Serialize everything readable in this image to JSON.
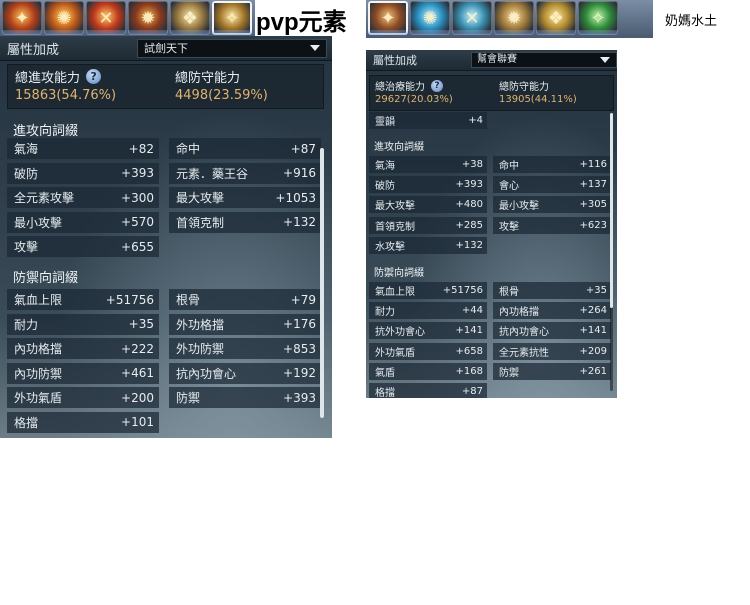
{
  "page_title": "pvp元素",
  "secondary_title": "奶媽水土",
  "left_strip": {
    "icons": [
      "fire-orb-icon",
      "flame-burst-icon",
      "fire-cross-icon",
      "fire-swirl-icon",
      "golden-wing-icon",
      "golden-dragon-icon"
    ],
    "colors": [
      [
        "#f7c35a",
        "#b4401a"
      ],
      [
        "#ffd86b",
        "#c25a18"
      ],
      [
        "#ffcf6a",
        "#c0391c"
      ],
      [
        "#f0b04a",
        "#8a3a1e"
      ],
      [
        "#f4e8b0",
        "#9a7a40"
      ],
      [
        "#ffe9a8",
        "#a07428"
      ]
    ]
  },
  "right_strip": {
    "icons": [
      "fire-sigil-icon",
      "water-vortex-icon",
      "water-ring-icon",
      "earth-ring-icon",
      "golden-star-icon",
      "nature-orb-icon"
    ],
    "colors": [
      [
        "#f1c07a",
        "#8a4a24"
      ],
      [
        "#aef0ff",
        "#2a8fc0"
      ],
      [
        "#c8f4ff",
        "#3a90b0"
      ],
      [
        "#f5e0a0",
        "#a07a3a"
      ],
      [
        "#ffe89a",
        "#b08a30"
      ],
      [
        "#b8f5a8",
        "#2f8a3a"
      ]
    ]
  },
  "left_panel": {
    "header_label": "屬性加成",
    "dropdown_value": "試劍天下",
    "summary": {
      "attack_title": "總進攻能力",
      "attack_value": "15863(54.76%)",
      "defense_title": "總防守能力",
      "defense_value": "4498(23.59%)"
    },
    "attack_section_title": "進攻向詞綴",
    "attack_rows": [
      {
        "label": "氣海",
        "value": "+82"
      },
      {
        "label": "命中",
        "value": "+87"
      },
      {
        "label": "破防",
        "value": "+393"
      },
      {
        "label": "元素．藥王谷",
        "value": "+916"
      },
      {
        "label": "全元素攻擊",
        "value": "+300"
      },
      {
        "label": "最大攻擊",
        "value": "+1053"
      },
      {
        "label": "最小攻擊",
        "value": "+570"
      },
      {
        "label": "首領克制",
        "value": "+132"
      },
      {
        "label": "攻擊",
        "value": "+655"
      }
    ],
    "defense_section_title": "防禦向詞綴",
    "defense_rows": [
      {
        "label": "氣血上限",
        "value": "+51756"
      },
      {
        "label": "根骨",
        "value": "+79"
      },
      {
        "label": "耐力",
        "value": "+35"
      },
      {
        "label": "外功格擋",
        "value": "+176"
      },
      {
        "label": "內功格擋",
        "value": "+222"
      },
      {
        "label": "外功防禦",
        "value": "+853"
      },
      {
        "label": "內功防禦",
        "value": "+461"
      },
      {
        "label": "抗內功會心",
        "value": "+192"
      },
      {
        "label": "外功氣盾",
        "value": "+200"
      },
      {
        "label": "防禦",
        "value": "+393"
      },
      {
        "label": "格擋",
        "value": "+101"
      }
    ]
  },
  "right_panel": {
    "header_label": "屬性加成",
    "dropdown_value": "幫會聯賽",
    "summary": {
      "heal_title": "總治療能力",
      "heal_value": "29627(20.03%)",
      "defense_title": "總防守能力",
      "defense_value": "13905(44.11%)"
    },
    "top_row": {
      "label": "靈韻",
      "value": "+4"
    },
    "attack_section_title": "進攻向詞綴",
    "attack_rows": [
      {
        "label": "氣海",
        "value": "+38"
      },
      {
        "label": "命中",
        "value": "+116"
      },
      {
        "label": "破防",
        "value": "+393"
      },
      {
        "label": "會心",
        "value": "+137"
      },
      {
        "label": "最大攻擊",
        "value": "+480"
      },
      {
        "label": "最小攻擊",
        "value": "+305"
      },
      {
        "label": "首領克制",
        "value": "+285"
      },
      {
        "label": "攻擊",
        "value": "+623"
      },
      {
        "label": "水攻擊",
        "value": "+132"
      }
    ],
    "defense_section_title": "防禦向詞綴",
    "defense_rows": [
      {
        "label": "氣血上限",
        "value": "+51756"
      },
      {
        "label": "根骨",
        "value": "+35"
      },
      {
        "label": "耐力",
        "value": "+44"
      },
      {
        "label": "內功格擋",
        "value": "+264"
      },
      {
        "label": "抗外功會心",
        "value": "+141"
      },
      {
        "label": "抗內功會心",
        "value": "+141"
      },
      {
        "label": "外功氣盾",
        "value": "+658"
      },
      {
        "label": "全元素抗性",
        "value": "+209"
      },
      {
        "label": "氣盾",
        "value": "+168"
      },
      {
        "label": "防禦",
        "value": "+261"
      },
      {
        "label": "格擋",
        "value": "+87"
      }
    ]
  }
}
